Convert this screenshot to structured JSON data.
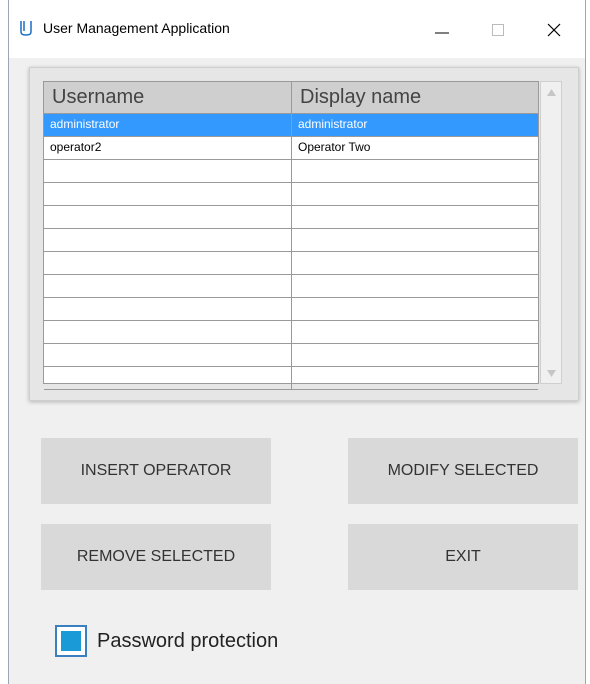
{
  "window": {
    "title": "User Management Application",
    "icon": "app-logo-icon"
  },
  "table": {
    "columns": [
      "Username",
      "Display name"
    ],
    "rows": [
      {
        "username": "administrator",
        "display_name": "administrator",
        "selected": true
      },
      {
        "username": "operator2",
        "display_name": "Operator Two",
        "selected": false
      }
    ],
    "empty_rows": 10
  },
  "buttons": {
    "insert": "INSERT OPERATOR",
    "modify": "MODIFY SELECTED",
    "remove": "REMOVE SELECTED",
    "exit": "EXIT"
  },
  "checkbox": {
    "label": "Password protection",
    "checked": true
  },
  "colors": {
    "selection": "#3399ff",
    "checkbox_fill": "#1a9bd7",
    "button_bg": "#d9d9d9"
  }
}
